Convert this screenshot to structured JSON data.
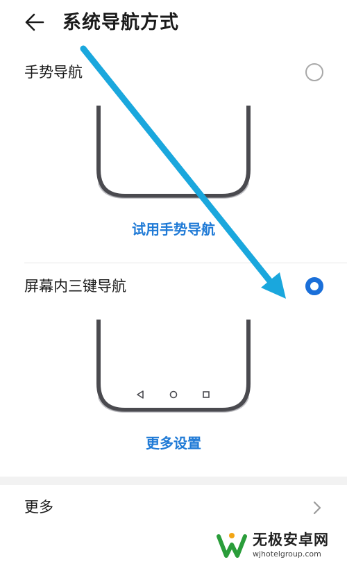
{
  "header": {
    "title": "系统导航方式"
  },
  "options": [
    {
      "label": "手势导航",
      "selected": false,
      "link": "试用手势导航"
    },
    {
      "label": "屏幕内三键导航",
      "selected": true,
      "link": "更多设置"
    }
  ],
  "more": {
    "label": "更多"
  },
  "watermark": {
    "title": "无极安卓网",
    "url": "wjhotelgroup.com"
  },
  "colors": {
    "accent": "#1a6fd9",
    "link": "#1f7ad6",
    "annotation_arrow": "#1aa7dd",
    "phone_frame": "#4a4a4f"
  },
  "icons": {
    "back": "arrow-left-icon",
    "more": "chevron-right-icon",
    "nav_buttons": [
      "triangle-back-icon",
      "circle-home-icon",
      "square-recents-icon"
    ]
  }
}
